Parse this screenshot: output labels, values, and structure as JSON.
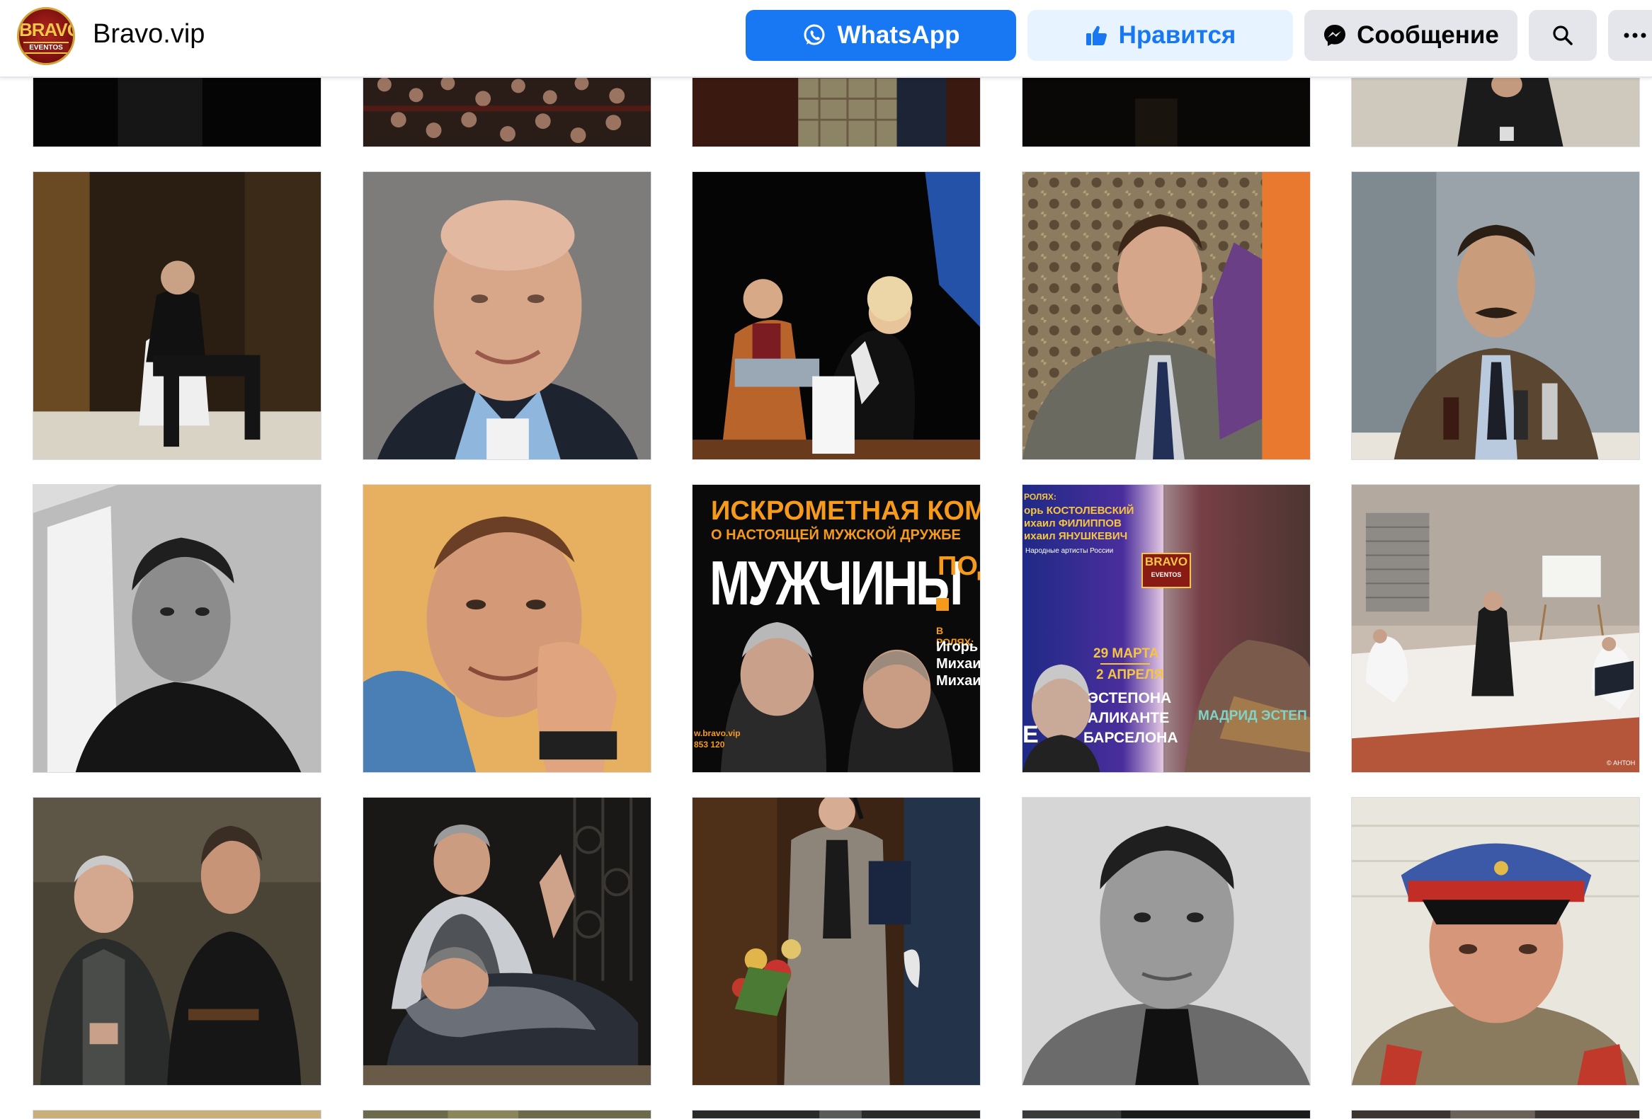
{
  "header": {
    "page_name": "Bravo.vip",
    "logo_top": "BRAVO",
    "logo_bottom": "EVENTOS",
    "buttons": {
      "whatsapp": "WhatsApp",
      "like": "Нравится",
      "message": "Сообщение"
    },
    "icons": {
      "whatsapp": "whatsapp-icon",
      "like": "thumbs-up-icon",
      "message": "messenger-icon",
      "search": "search-icon",
      "more": "more-dots-icon"
    }
  },
  "colors": {
    "primary": "#1877f2",
    "like_bg": "#e7f3ff",
    "secondary_bg": "#e4e6eb",
    "poster_orange": "#f59a1b"
  },
  "posters": {
    "comedy": {
      "headline": "ИСКРОМЕТНАЯ КОМЕ",
      "subhead": "О НАСТОЯЩЕЙ МУЖСКОЙ ДРУЖБЕ",
      "title": "МУЖЧИНЫ",
      "title_tail": "ПОД",
      "cast_label": "В РОЛЯХ:",
      "cast": [
        "Игорь",
        "Михаил",
        "Михаил"
      ],
      "site": "w.bravo.vip",
      "phone": "853 120"
    },
    "tour": {
      "cast_label": "РОЛЯХ:",
      "cast": [
        "орь КОСТОЛЕВСКИЙ",
        "ихаил ФИЛИППОВ",
        "ихаил ЯНУШКЕВИЧ"
      ],
      "note": "Народные артисты России",
      "logo_top": "BRAVO",
      "logo_bottom": "EVENTOS",
      "date1": "29 МАРТА",
      "date2": "2 АПРЕЛЯ",
      "cities": [
        "ЭСТЕПОНА",
        "АЛИКАНТЕ",
        "БАРСЕЛОНА"
      ],
      "left_fragment": "E",
      "footer": "МАДРИД  ЭСТЕП"
    },
    "watermark": "© АНТОН"
  },
  "photos": [
    "stage-dark-1",
    "audience-1",
    "checked-jacket-1",
    "stage-dark-2",
    "dark-suit-1",
    "actor-seated-stage",
    "smiling-portrait",
    "actors-on-stage-couple",
    "man-with-purple-knit",
    "man-with-mustache-bottles",
    "bw-portrait-young",
    "hand-on-chin-portrait",
    "poster-comedy",
    "poster-tour",
    "stage-white-set",
    "two-actors-stage",
    "sleeping-actor-stage",
    "actor-with-flowers",
    "bw-portrait-mature",
    "officer-cap-portrait",
    "row5-1",
    "row5-2",
    "row5-3",
    "row5-4",
    "row5-5"
  ]
}
